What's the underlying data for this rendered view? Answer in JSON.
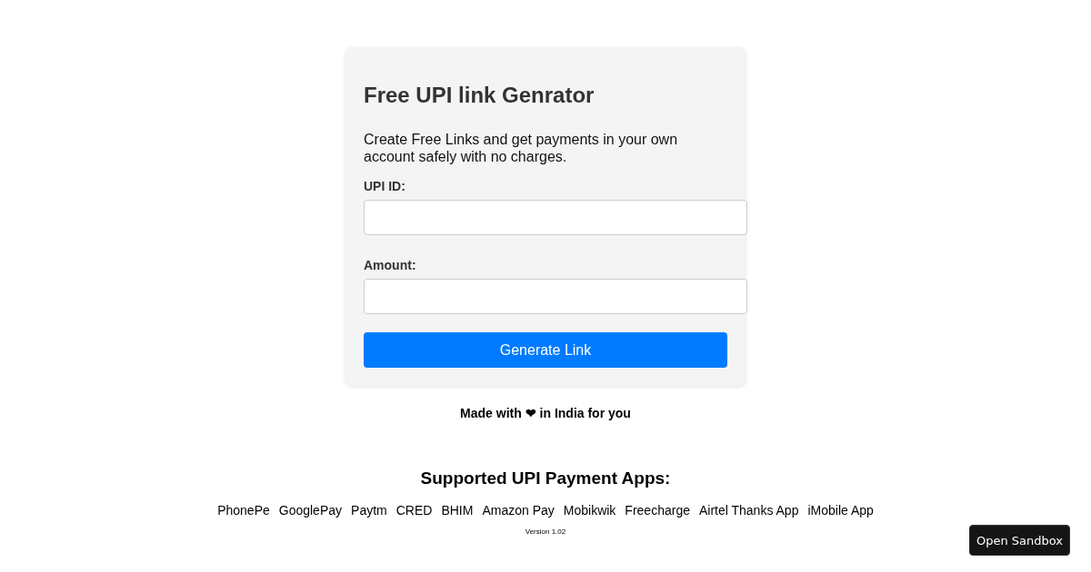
{
  "form": {
    "title": "Free UPI link Genrator",
    "description": "Create Free Links and get payments in your own account safely with no charges.",
    "fields": [
      {
        "label": "UPI ID:"
      },
      {
        "label": "Amount:"
      }
    ],
    "button": "Generate Link"
  },
  "tagline": "Made with ❤ in India for you",
  "supported": {
    "heading": "Supported UPI Payment Apps:",
    "apps": [
      "PhonePe",
      "GooglePay",
      "Paytm",
      "CRED",
      "BHIM",
      "Amazon Pay",
      "Mobikwik",
      "Freecharge",
      "Airtel Thanks App",
      "iMobile App"
    ]
  },
  "version": "Version 1.02",
  "sandbox_button": "Open Sandbox"
}
